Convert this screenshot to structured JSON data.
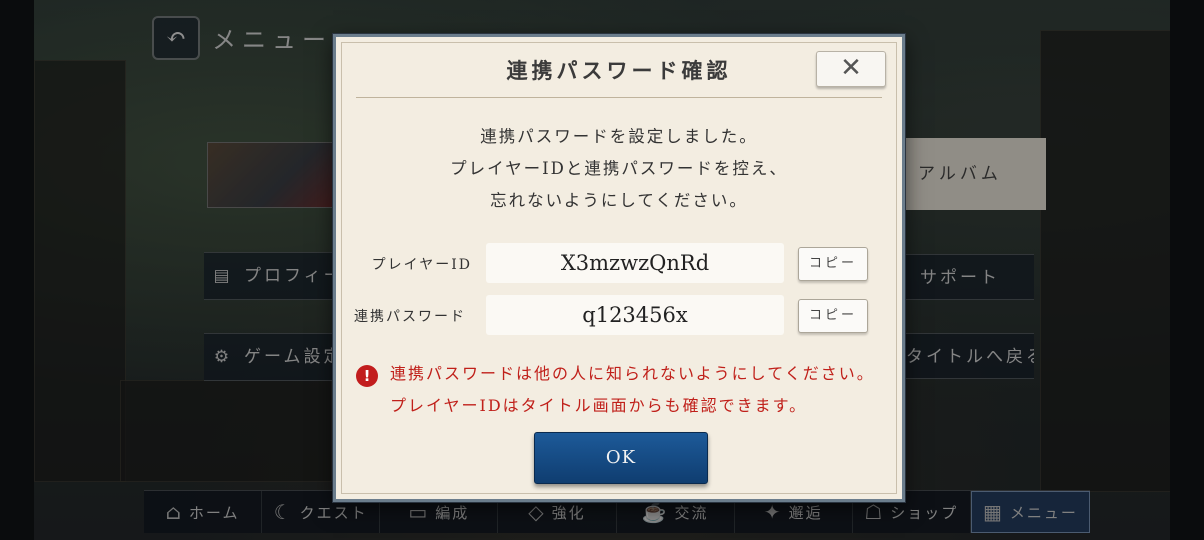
{
  "background": {
    "menu_title": "メニュー",
    "profile_label": "プロフィール",
    "settings_label": "ゲーム設定",
    "album_label": "アルバム",
    "support_label": "サポート",
    "return_title_label": "タイトルへ戻る",
    "nav": [
      {
        "label": "ホーム",
        "icon": "home-icon"
      },
      {
        "label": "クエスト",
        "icon": "moon-icon"
      },
      {
        "label": "編成",
        "icon": "formation-icon"
      },
      {
        "label": "強化",
        "icon": "enhance-icon"
      },
      {
        "label": "交流",
        "icon": "cup-icon"
      },
      {
        "label": "邂逅",
        "icon": "star-icon"
      },
      {
        "label": "ショップ",
        "icon": "shop-icon"
      },
      {
        "label": "メニュー",
        "icon": "grid-icon"
      }
    ],
    "active_nav": "メニュー"
  },
  "dialog": {
    "title": "連携パスワード確認",
    "close_symbol": "✕",
    "message_lines": [
      "連携パスワードを設定しました。",
      "プレイヤーIDと連携パスワードを控え、",
      "忘れないようにしてください。"
    ],
    "player_id_label": "プレイヤーID",
    "player_id_value": "X3mzwzQnRd",
    "password_label": "連携パスワード",
    "password_value": "q123456x",
    "copy_label": "コピー",
    "warning_symbol": "!",
    "warning_lines": [
      "連携パスワードは他の人に知られないようにしてください。",
      "プレイヤーIDはタイトル画面からも確認できます。"
    ],
    "ok_label": "OK",
    "warning_color": "#c0201a",
    "ok_color": "#174b85"
  }
}
